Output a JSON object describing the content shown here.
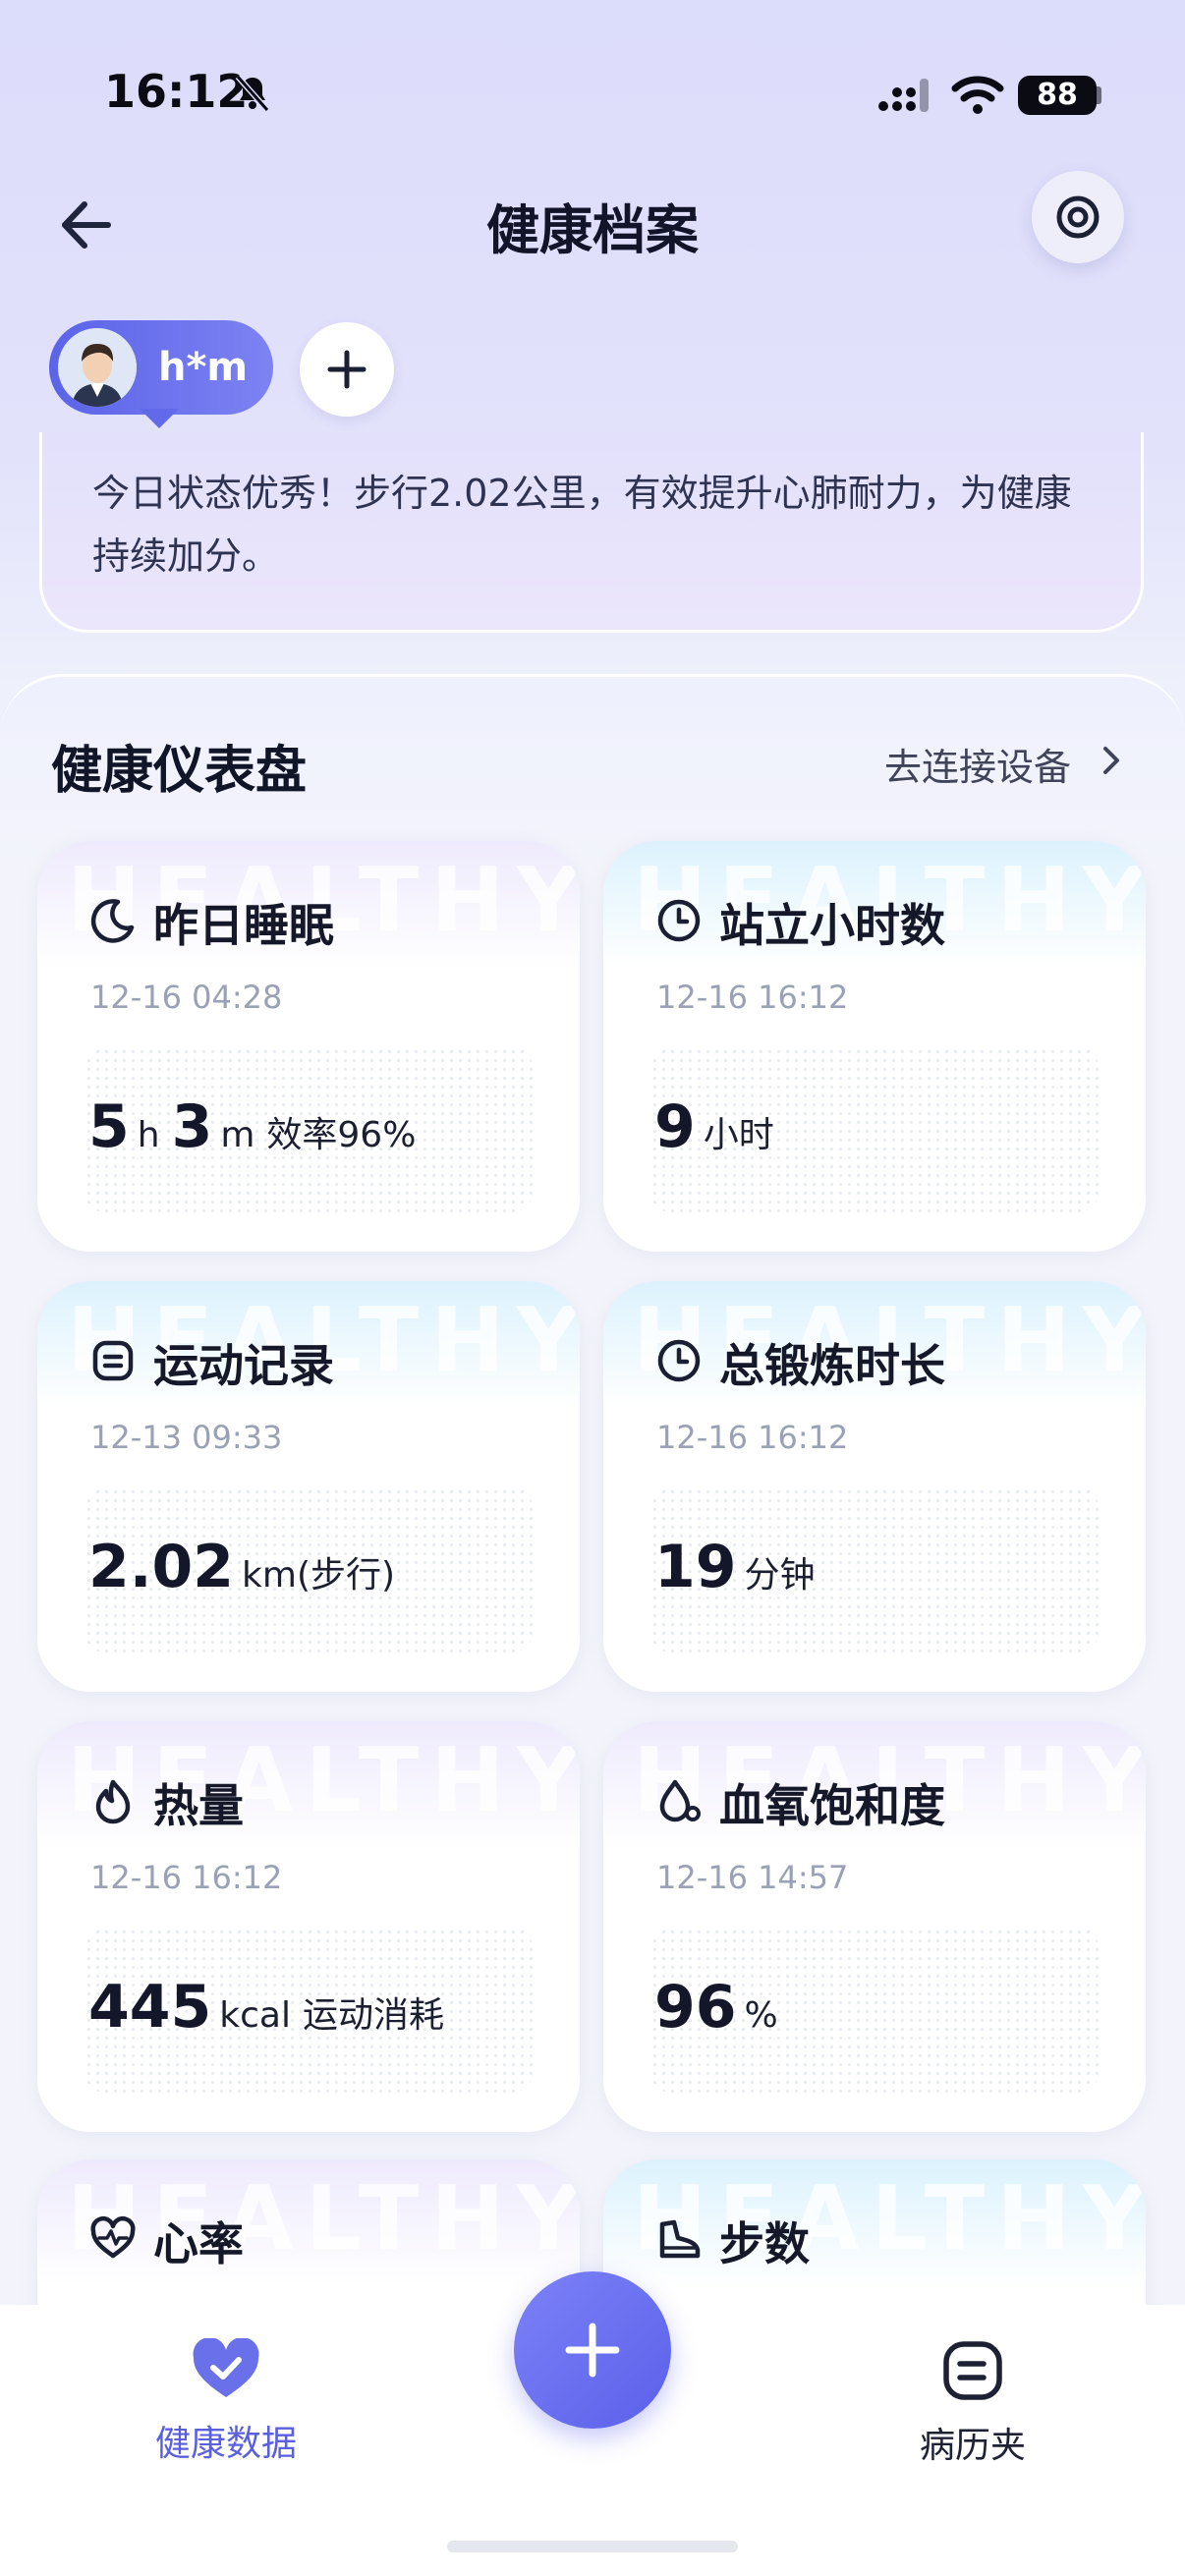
{
  "status_bar": {
    "time": "16:12",
    "battery": "88"
  },
  "header": {
    "title": "健康档案"
  },
  "profile": {
    "name": "h*m"
  },
  "status_note": {
    "text": "今日状态优秀！步行2.02公里，有效提升心肺耐力，为健康持续加分。"
  },
  "dashboard": {
    "title": "健康仪表盘",
    "connect_label": "去连接设备",
    "watermark": "HEALTHY",
    "cards": [
      {
        "title": "昨日睡眠",
        "time": "12-16 04:28",
        "value": "5",
        "unit": "h",
        "value2": "3",
        "unit2": "m",
        "extra": "效率96%",
        "icon": "moon-icon"
      },
      {
        "title": "站立小时数",
        "time": "12-16 16:12",
        "value": "9",
        "unit": "小时",
        "icon": "clock-icon"
      },
      {
        "title": "运动记录",
        "time": "12-13 09:33",
        "value": "2.02",
        "unit": "km(步行)",
        "icon": "record-icon"
      },
      {
        "title": "总锻炼时长",
        "time": "12-16 16:12",
        "value": "19",
        "unit": "分钟",
        "icon": "clock-icon"
      },
      {
        "title": "热量",
        "time": "12-16 16:12",
        "value": "445",
        "unit": "kcal",
        "extra": "运动消耗",
        "icon": "flame-icon"
      },
      {
        "title": "血氧饱和度",
        "time": "12-16 14:57",
        "value": "96",
        "unit": "%",
        "icon": "drop-icon"
      },
      {
        "title": "心率",
        "icon": "heart-pulse-icon"
      },
      {
        "title": "步数",
        "icon": "shoe-icon"
      }
    ]
  },
  "tab_bar": {
    "health_label": "健康数据",
    "records_label": "病历夹"
  },
  "colors": {
    "accent": "#5b60ea",
    "title": "#12152a",
    "muted": "#9aa1b4"
  }
}
